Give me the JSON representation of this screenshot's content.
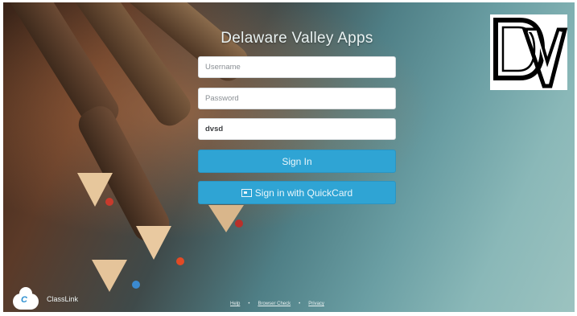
{
  "app": {
    "title": "Delaware Valley Apps"
  },
  "form": {
    "username_placeholder": "Username",
    "password_placeholder": "Password",
    "district_value": "dvsd",
    "sign_in_label": "Sign In",
    "quickcard_label": "Sign in with QuickCard"
  },
  "brand": {
    "logo_text": "DV",
    "classlink_label": "ClassLink"
  },
  "footer": {
    "help": "Help",
    "browser_check": "Browser Check",
    "privacy": "Privacy",
    "separator": "•"
  },
  "colors": {
    "button": "#2fa4d4",
    "title_text": "#e9f2f2"
  },
  "icons": {
    "quickcard": "id-card-icon",
    "classlink": "cloud-icon",
    "external": "external-link-icon"
  }
}
